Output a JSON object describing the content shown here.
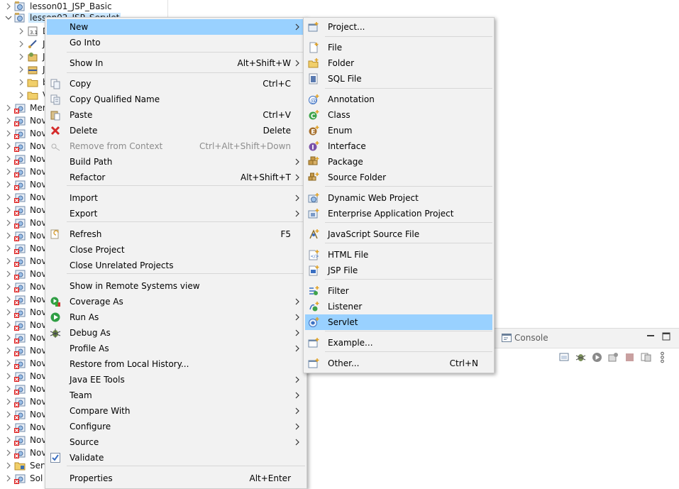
{
  "explorer": {
    "items": [
      {
        "label": "lesson01_JSP_Basic",
        "expanded": false,
        "icon": "web-project-icon"
      },
      {
        "label": "lesson02_JSP_Servlet",
        "expanded": true,
        "icon": "web-project-icon"
      },
      {
        "label": "D",
        "icon": "deployment-descriptor-icon"
      },
      {
        "label": "J",
        "icon": "jax-ws-icon"
      },
      {
        "label": "J",
        "icon": "java-resources-icon"
      },
      {
        "label": "J",
        "icon": "javascript-resources-icon"
      },
      {
        "label": "b",
        "icon": "folder-icon"
      },
      {
        "label": "V",
        "icon": "folder-icon"
      },
      {
        "label": "Mer",
        "icon": "error-project-icon"
      },
      {
        "label": "Nov",
        "icon": "error-project-icon"
      },
      {
        "label": "Nov",
        "icon": "error-project-icon"
      },
      {
        "label": "Nov",
        "icon": "error-project-icon"
      },
      {
        "label": "Nov",
        "icon": "error-project-icon"
      },
      {
        "label": "Nov",
        "icon": "error-project-icon"
      },
      {
        "label": "Nov",
        "icon": "error-project-icon"
      },
      {
        "label": "Nov",
        "icon": "error-project-icon"
      },
      {
        "label": "Nov",
        "icon": "error-project-icon"
      },
      {
        "label": "Nov",
        "icon": "error-project-icon"
      },
      {
        "label": "Nov",
        "icon": "error-project-icon"
      },
      {
        "label": "Nov",
        "icon": "error-project-icon"
      },
      {
        "label": "Nov",
        "icon": "error-project-icon"
      },
      {
        "label": "Nov",
        "icon": "error-project-icon"
      },
      {
        "label": "Nov",
        "icon": "error-project-icon"
      },
      {
        "label": "Nov",
        "icon": "error-project-icon"
      },
      {
        "label": "Nov",
        "icon": "error-project-icon"
      },
      {
        "label": "Nov",
        "icon": "error-project-icon"
      },
      {
        "label": "Nov",
        "icon": "error-project-icon"
      },
      {
        "label": "Nov",
        "icon": "error-project-icon"
      },
      {
        "label": "Nov",
        "icon": "error-project-icon"
      },
      {
        "label": "Nov",
        "icon": "error-project-icon"
      },
      {
        "label": "Nov",
        "icon": "error-project-icon"
      },
      {
        "label": "Nov",
        "icon": "error-project-icon"
      },
      {
        "label": "Nov",
        "icon": "error-project-icon"
      },
      {
        "label": "Nov",
        "icon": "error-project-icon"
      },
      {
        "label": "Nov",
        "icon": "error-project-icon"
      },
      {
        "label": "Nov",
        "icon": "error-project-icon"
      },
      {
        "label": "Serv",
        "icon": "servers-folder-icon"
      },
      {
        "label": "Sol",
        "icon": "error-project-icon"
      }
    ]
  },
  "console": {
    "tab_label": "Console",
    "toolbar_icons": [
      "clear-console-icon",
      "debug-icon",
      "run-icon",
      "pin-icon",
      "stop-icon",
      "display-console-icon",
      "view-menu-icon"
    ]
  },
  "context_menu": {
    "items": [
      {
        "label": "New",
        "accel": "",
        "submenu": true,
        "icon": "",
        "highlight": true
      },
      {
        "label": "Go Into",
        "accel": "",
        "submenu": false,
        "icon": ""
      },
      {
        "sep": true
      },
      {
        "label": "Show In",
        "accel": "Alt+Shift+W",
        "submenu": true,
        "icon": ""
      },
      {
        "sep": true
      },
      {
        "label": "Copy",
        "accel": "Ctrl+C",
        "submenu": false,
        "icon": "copy-icon"
      },
      {
        "label": "Copy Qualified Name",
        "accel": "",
        "submenu": false,
        "icon": "copy-qualified-icon"
      },
      {
        "label": "Paste",
        "accel": "Ctrl+V",
        "submenu": false,
        "icon": "paste-icon"
      },
      {
        "label": "Delete",
        "accel": "Delete",
        "submenu": false,
        "icon": "delete-icon"
      },
      {
        "label": "Remove from Context",
        "accel": "Ctrl+Alt+Shift+Down",
        "submenu": false,
        "icon": "remove-context-icon",
        "disabled": true
      },
      {
        "label": "Build Path",
        "accel": "",
        "submenu": true,
        "icon": ""
      },
      {
        "label": "Refactor",
        "accel": "Alt+Shift+T",
        "submenu": true,
        "icon": ""
      },
      {
        "sep": true
      },
      {
        "label": "Import",
        "accel": "",
        "submenu": true,
        "icon": ""
      },
      {
        "label": "Export",
        "accel": "",
        "submenu": true,
        "icon": ""
      },
      {
        "sep": true
      },
      {
        "label": "Refresh",
        "accel": "F5",
        "submenu": false,
        "icon": "refresh-icon"
      },
      {
        "label": "Close Project",
        "accel": "",
        "submenu": false,
        "icon": ""
      },
      {
        "label": "Close Unrelated Projects",
        "accel": "",
        "submenu": false,
        "icon": ""
      },
      {
        "sep": true
      },
      {
        "label": "Show in Remote Systems view",
        "accel": "",
        "submenu": false,
        "icon": ""
      },
      {
        "label": "Coverage As",
        "accel": "",
        "submenu": true,
        "icon": "coverage-icon"
      },
      {
        "label": "Run As",
        "accel": "",
        "submenu": true,
        "icon": "run-icon"
      },
      {
        "label": "Debug As",
        "accel": "",
        "submenu": true,
        "icon": "debug-icon"
      },
      {
        "label": "Profile As",
        "accel": "",
        "submenu": true,
        "icon": ""
      },
      {
        "label": "Restore from Local History...",
        "accel": "",
        "submenu": false,
        "icon": ""
      },
      {
        "label": "Java EE Tools",
        "accel": "",
        "submenu": true,
        "icon": ""
      },
      {
        "label": "Team",
        "accel": "",
        "submenu": true,
        "icon": ""
      },
      {
        "label": "Compare With",
        "accel": "",
        "submenu": true,
        "icon": ""
      },
      {
        "label": "Configure",
        "accel": "",
        "submenu": true,
        "icon": ""
      },
      {
        "label": "Source",
        "accel": "",
        "submenu": true,
        "icon": ""
      },
      {
        "label": "Validate",
        "accel": "",
        "submenu": false,
        "icon": "validate-check-icon"
      },
      {
        "sep": true
      },
      {
        "label": "Properties",
        "accel": "Alt+Enter",
        "submenu": false,
        "icon": ""
      }
    ]
  },
  "new_submenu": {
    "items": [
      {
        "label": "Project...",
        "accel": "",
        "icon": "new-project-icon"
      },
      {
        "sep": true
      },
      {
        "label": "File",
        "accel": "",
        "icon": "new-file-icon"
      },
      {
        "label": "Folder",
        "accel": "",
        "icon": "new-folder-icon"
      },
      {
        "label": "SQL File",
        "accel": "",
        "icon": "sql-file-icon"
      },
      {
        "sep": true
      },
      {
        "label": "Annotation",
        "accel": "",
        "icon": "annotation-icon"
      },
      {
        "label": "Class",
        "accel": "",
        "icon": "class-icon"
      },
      {
        "label": "Enum",
        "accel": "",
        "icon": "enum-icon"
      },
      {
        "label": "Interface",
        "accel": "",
        "icon": "interface-icon"
      },
      {
        "label": "Package",
        "accel": "",
        "icon": "package-icon"
      },
      {
        "label": "Source Folder",
        "accel": "",
        "icon": "source-folder-icon"
      },
      {
        "sep": true
      },
      {
        "label": "Dynamic Web Project",
        "accel": "",
        "icon": "dynamic-web-project-icon"
      },
      {
        "label": "Enterprise Application Project",
        "accel": "",
        "icon": "enterprise-app-project-icon"
      },
      {
        "sep": true
      },
      {
        "label": "JavaScript Source File",
        "accel": "",
        "icon": "javascript-file-icon"
      },
      {
        "sep": true
      },
      {
        "label": "HTML File",
        "accel": "",
        "icon": "html-file-icon"
      },
      {
        "label": "JSP File",
        "accel": "",
        "icon": "jsp-file-icon"
      },
      {
        "sep": true
      },
      {
        "label": "Filter",
        "accel": "",
        "icon": "filter-icon"
      },
      {
        "label": "Listener",
        "accel": "",
        "icon": "listener-icon"
      },
      {
        "label": "Servlet",
        "accel": "",
        "icon": "servlet-icon",
        "highlight": true
      },
      {
        "sep": true
      },
      {
        "label": "Example...",
        "accel": "",
        "icon": "example-icon"
      },
      {
        "sep": true
      },
      {
        "label": "Other...",
        "accel": "Ctrl+N",
        "icon": "other-wizard-icon"
      }
    ]
  },
  "colors": {
    "highlight": "#99d1ff",
    "menu_bg": "#f2f2f2",
    "selection": "#cce8ff"
  }
}
